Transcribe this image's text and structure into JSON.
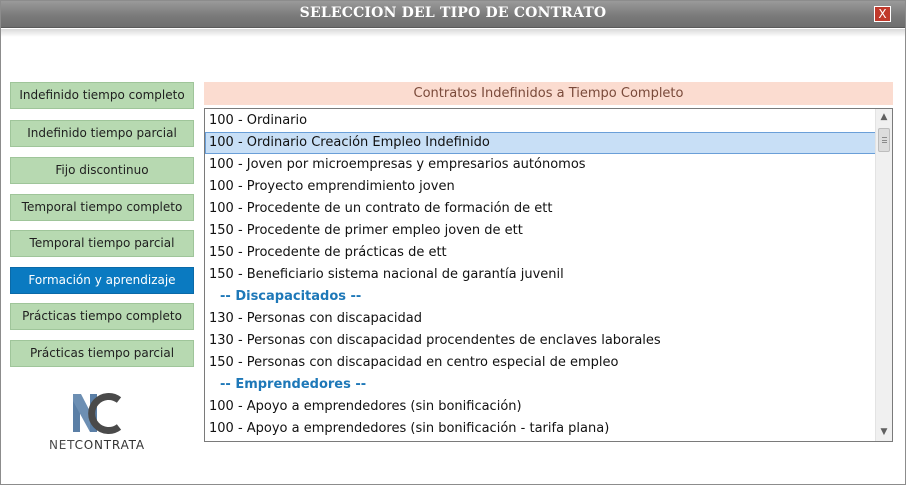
{
  "window": {
    "title": "SELECCION DEL TIPO DE CONTRATO",
    "close_label": "X"
  },
  "sidebar": {
    "items": [
      {
        "label": "Indefinido tiempo completo",
        "active": false
      },
      {
        "label": "Indefinido tiempo parcial",
        "active": false
      },
      {
        "label": "Fijo discontinuo",
        "active": false
      },
      {
        "label": "Temporal tiempo completo",
        "active": false
      },
      {
        "label": "Temporal tiempo parcial",
        "active": false
      },
      {
        "label": "Formación y aprendizaje",
        "active": true
      },
      {
        "label": "Prácticas tiempo completo",
        "active": false
      },
      {
        "label": "Prácticas tiempo parcial",
        "active": false
      }
    ]
  },
  "logo": {
    "mark": "NC",
    "text_net": "NET",
    "text_contrata": "CONTRATA"
  },
  "list": {
    "header": "Contratos Indefinidos a Tiempo Completo",
    "rows": [
      {
        "text": "100 - Ordinario",
        "type": "item"
      },
      {
        "text": "100 - Ordinario Creación Empleo Indefinido",
        "type": "item",
        "selected": true
      },
      {
        "text": "100 - Joven por microempresas y empresarios autónomos",
        "type": "item"
      },
      {
        "text": "100 - Proyecto emprendimiento joven",
        "type": "item"
      },
      {
        "text": "100 - Procedente de un contrato de formación de ett",
        "type": "item"
      },
      {
        "text": "150 - Procedente de primer empleo joven de ett",
        "type": "item"
      },
      {
        "text": "150 - Procedente de prácticas de ett",
        "type": "item"
      },
      {
        "text": "150 - Beneficiario sistema nacional de garantía juvenil",
        "type": "item"
      },
      {
        "text": "-- Discapacitados --",
        "type": "section"
      },
      {
        "text": "130 - Personas con discapacidad",
        "type": "item"
      },
      {
        "text": "130 - Personas con discapacidad procendentes de enclaves laborales",
        "type": "item"
      },
      {
        "text": "150 - Personas con discapacidad en centro especial de empleo",
        "type": "item"
      },
      {
        "text": "-- Emprendedores --",
        "type": "section"
      },
      {
        "text": "100 - Apoyo a emprendedores (sin bonificación)",
        "type": "item"
      },
      {
        "text": "100 - Apoyo a emprendedores (sin bonificación - tarifa plana)",
        "type": "item"
      }
    ]
  },
  "colors": {
    "sidebar_bg": "#b7d9b1",
    "sidebar_active_bg": "#0a7ac1",
    "header_bg": "#fbdcd0",
    "section_text": "#1e78b8",
    "selected_bg": "#c8dff6",
    "logo_blue": "#5b7fa6",
    "logo_gray": "#555555"
  },
  "icons": {
    "close": "close-icon",
    "scroll_up": "arrow-up-icon",
    "scroll_down": "arrow-down-icon"
  }
}
